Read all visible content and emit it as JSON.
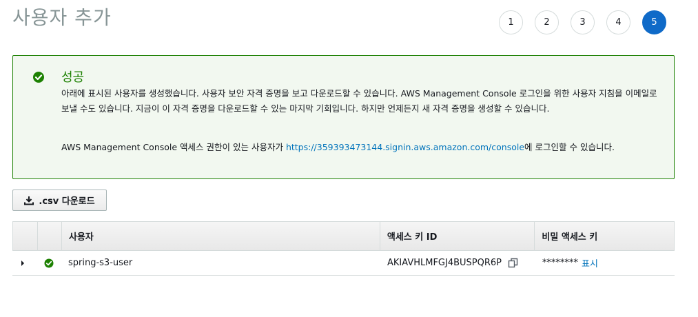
{
  "page": {
    "title": "사용자 추가"
  },
  "steps": [
    "1",
    "2",
    "3",
    "4",
    "5"
  ],
  "active_step": "5",
  "alert": {
    "title": "성공",
    "body": "아래에 표시된 사용자를 생성했습니다. 사용자 보안 자격 증명을 보고 다운로드할 수 있습니다. AWS Management Console 로그인을 위한 사용자 지침을 이메일로 보낼 수도 있습니다. 지금이 이 자격 증명을 다운로드할 수 있는 마지막 기회입니다. 하지만 언제든지 새 자격 증명을 생성할 수 있습니다.",
    "login_prefix": "AWS Management Console 액세스 권한이 있는 사용자가 ",
    "login_url": "https://359393473144.signin.aws.amazon.com/console",
    "login_suffix": "에 로그인할 수 있습니다.",
    "icon": "check-circle-icon",
    "color": "#1d8102"
  },
  "download_button": {
    "label": ".csv 다운로드",
    "icon": "download-icon"
  },
  "table": {
    "headers": [
      "사용자",
      "액세스 키 ID",
      "비밀 액세스 키"
    ],
    "rows": [
      {
        "user": "spring-s3-user",
        "access_key_id": "AKIAVHLMFGJ4BUSPQR6P",
        "secret_masked": "********",
        "show_label": "표시"
      }
    ]
  },
  "colors": {
    "accent": "#0f6ac8",
    "link": "#0073bb",
    "success": "#1d8102"
  }
}
